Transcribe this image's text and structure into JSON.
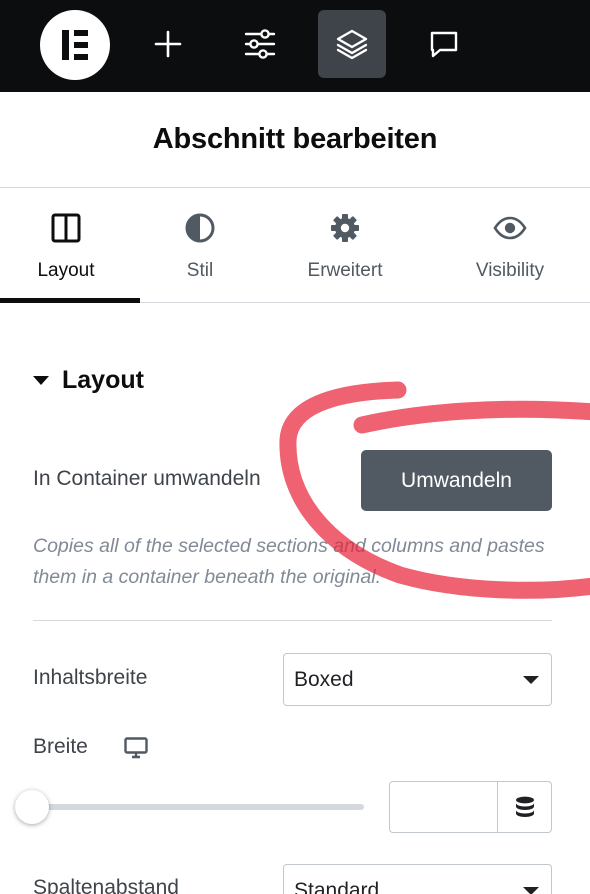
{
  "toolbar": {
    "logo_icon": "elementor-logo-icon",
    "buttons": [
      {
        "icon": "plus-icon"
      },
      {
        "icon": "sliders-icon"
      },
      {
        "icon": "layers-icon",
        "active": true
      },
      {
        "icon": "chat-icon"
      }
    ]
  },
  "header": {
    "title": "Abschnitt bearbeiten"
  },
  "tabs": [
    {
      "label": "Layout",
      "icon": "columns-icon",
      "active": true
    },
    {
      "label": "Stil",
      "icon": "contrast-icon"
    },
    {
      "label": "Erweitert",
      "icon": "gear-icon"
    },
    {
      "label": "Visibility",
      "icon": "eye-icon"
    }
  ],
  "section": {
    "title": "Layout",
    "convert": {
      "label": "In Container umwandeln",
      "button": "Umwandeln",
      "help": "Copies all of the selected sections and columns and pastes them in a container beneath the original."
    },
    "content_width": {
      "label": "Inhaltsbreite",
      "value": "Boxed"
    },
    "width": {
      "label": "Breite",
      "device_icon": "desktop-icon",
      "value": "",
      "slider_fraction": 0
    },
    "gap": {
      "label": "Spaltenabstand",
      "value": "Standard"
    }
  },
  "colors": {
    "toolbar_bg": "#0c0d0e",
    "button_bg": "#515962",
    "annotation": "#e8253b"
  }
}
